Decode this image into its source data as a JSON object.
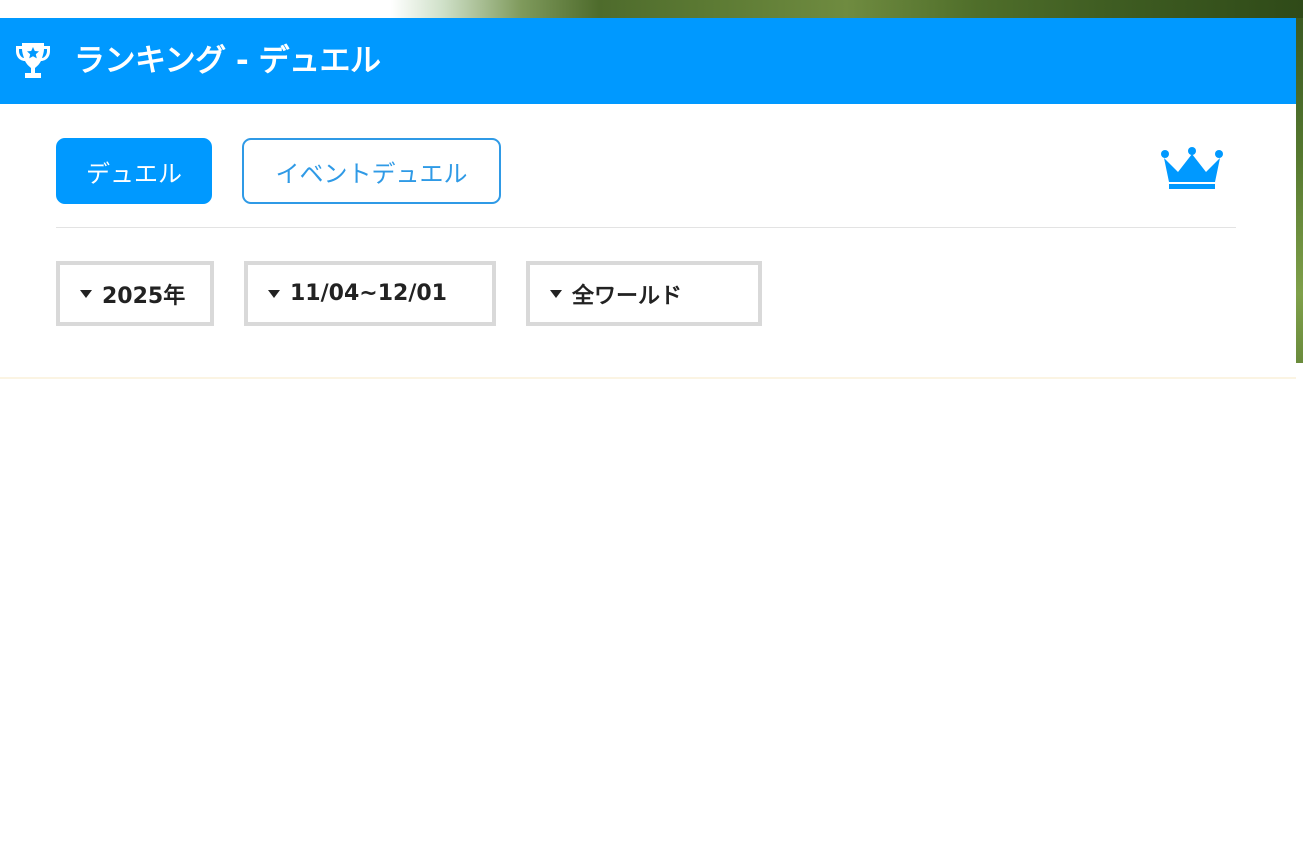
{
  "header": {
    "title": "ランキング - デュエル",
    "icon": "trophy-icon",
    "background_color": "#0099ff"
  },
  "tabs": [
    {
      "label": "デュエル",
      "active": true
    },
    {
      "label": "イベントデュエル",
      "active": false
    }
  ],
  "crown": {
    "icon": "crown-icon",
    "color": "#0099ff"
  },
  "filters": {
    "year": {
      "selected": "2025年"
    },
    "period": {
      "selected": "11/04~12/01"
    },
    "world": {
      "selected": "全ワールド"
    }
  },
  "colors": {
    "accent": "#0099ff",
    "tab_border": "#2f9ae6",
    "select_border": "#d9d9d9"
  }
}
